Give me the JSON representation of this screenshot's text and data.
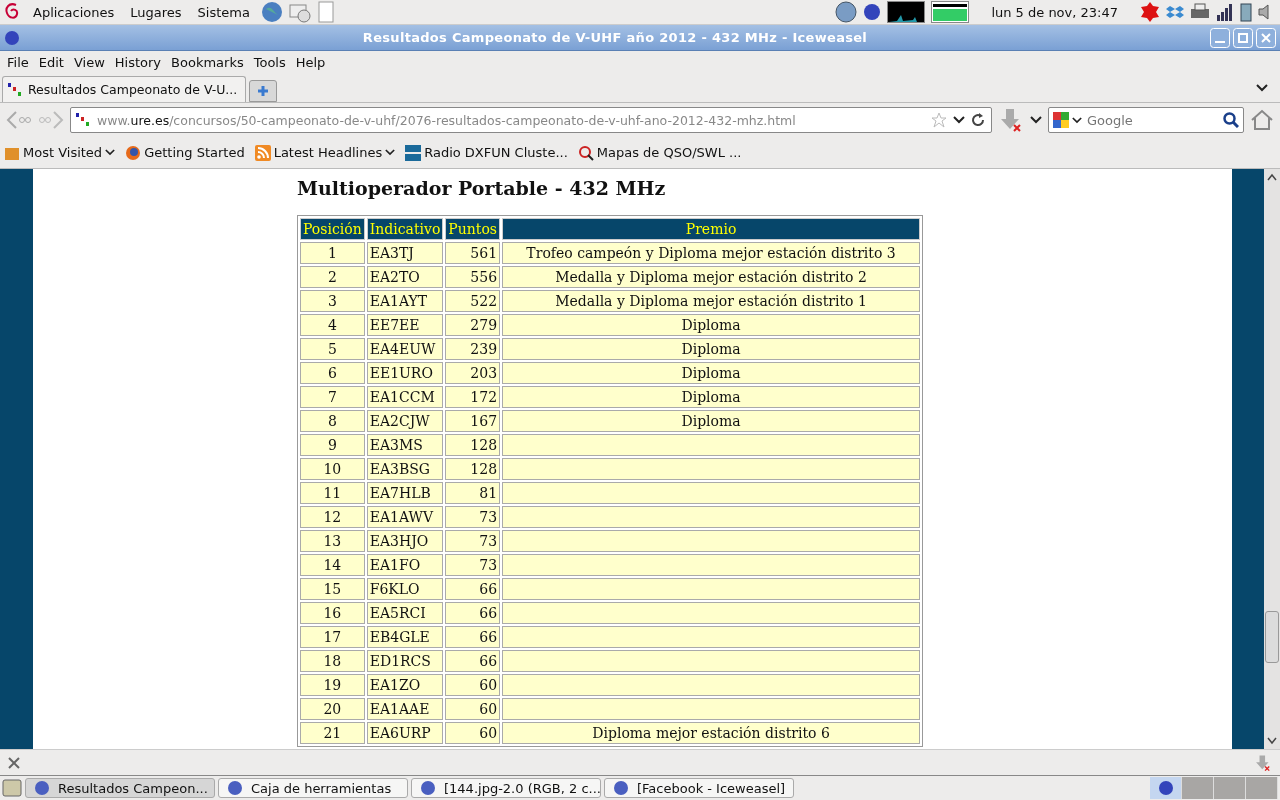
{
  "top_panel": {
    "menus": [
      "Aplicaciones",
      "Lugares",
      "Sistema"
    ],
    "clock": "lun  5 de nov, 23:47"
  },
  "window": {
    "title": "Resultados Campeonato de V-UHF año 2012 - 432 MHz - Iceweasel"
  },
  "menubar": [
    "File",
    "Edit",
    "View",
    "History",
    "Bookmarks",
    "Tools",
    "Help"
  ],
  "tabs": [
    {
      "label": "Resultados Campeonato de V-U...",
      "selected": true
    }
  ],
  "address": {
    "domain_prefix": "www.",
    "domain": "ure.es",
    "path": "/concursos/50-campeonato-de-v-uhf/2076-resultados-campeonato-de-v-uhf-ano-2012-432-mhz.html"
  },
  "search": {
    "placeholder": "Google"
  },
  "bookmarks": [
    {
      "label": "Most Visited",
      "kind": "folder"
    },
    {
      "label": "Getting Started",
      "kind": "firefox"
    },
    {
      "label": "Latest Headlines",
      "kind": "feed"
    },
    {
      "label": "Radio DXFUN Cluste...",
      "kind": "dx"
    },
    {
      "label": "Mapas de QSO/SWL ...",
      "kind": "map"
    }
  ],
  "page": {
    "heading": "Multioperador Portable - 432 MHz",
    "table": {
      "columns": [
        "Posición",
        "Indicativo",
        "Puntos",
        "Premio"
      ],
      "rows": [
        [
          "1",
          "EA3TJ",
          "561",
          "Trofeo campeón y Diploma mejor estación distrito 3"
        ],
        [
          "2",
          "EA2TO",
          "556",
          "Medalla y Diploma mejor estación distrito 2"
        ],
        [
          "3",
          "EA1AYT",
          "522",
          "Medalla y Diploma mejor estación distrito 1"
        ],
        [
          "4",
          "EE7EE",
          "279",
          "Diploma"
        ],
        [
          "5",
          "EA4EUW",
          "239",
          "Diploma"
        ],
        [
          "6",
          "EE1URO",
          "203",
          "Diploma"
        ],
        [
          "7",
          "EA1CCM",
          "172",
          "Diploma"
        ],
        [
          "8",
          "EA2CJW",
          "167",
          "Diploma"
        ],
        [
          "9",
          "EA3MS",
          "128",
          ""
        ],
        [
          "10",
          "EA3BSG",
          "128",
          ""
        ],
        [
          "11",
          "EA7HLB",
          "81",
          ""
        ],
        [
          "12",
          "EA1AWV",
          "73",
          ""
        ],
        [
          "13",
          "EA3HJO",
          "73",
          ""
        ],
        [
          "14",
          "EA1FO",
          "73",
          ""
        ],
        [
          "15",
          "F6KLO",
          "66",
          ""
        ],
        [
          "16",
          "EA5RCI",
          "66",
          ""
        ],
        [
          "17",
          "EB4GLE",
          "66",
          ""
        ],
        [
          "18",
          "ED1RCS",
          "66",
          ""
        ],
        [
          "19",
          "EA1ZO",
          "60",
          ""
        ],
        [
          "20",
          "EA1AAE",
          "60",
          ""
        ],
        [
          "21",
          "EA6URP",
          "60",
          "Diploma mejor estación distrito 6"
        ]
      ]
    }
  },
  "taskbar": [
    {
      "label": "Resultados Campeon...",
      "selected": true
    },
    {
      "label": "Caja de herramientas",
      "selected": false
    },
    {
      "label": "[144.jpg-2.0 (RGB, 2 c...",
      "selected": false
    },
    {
      "label": "[Facebook - Iceweasel]",
      "selected": false
    }
  ]
}
